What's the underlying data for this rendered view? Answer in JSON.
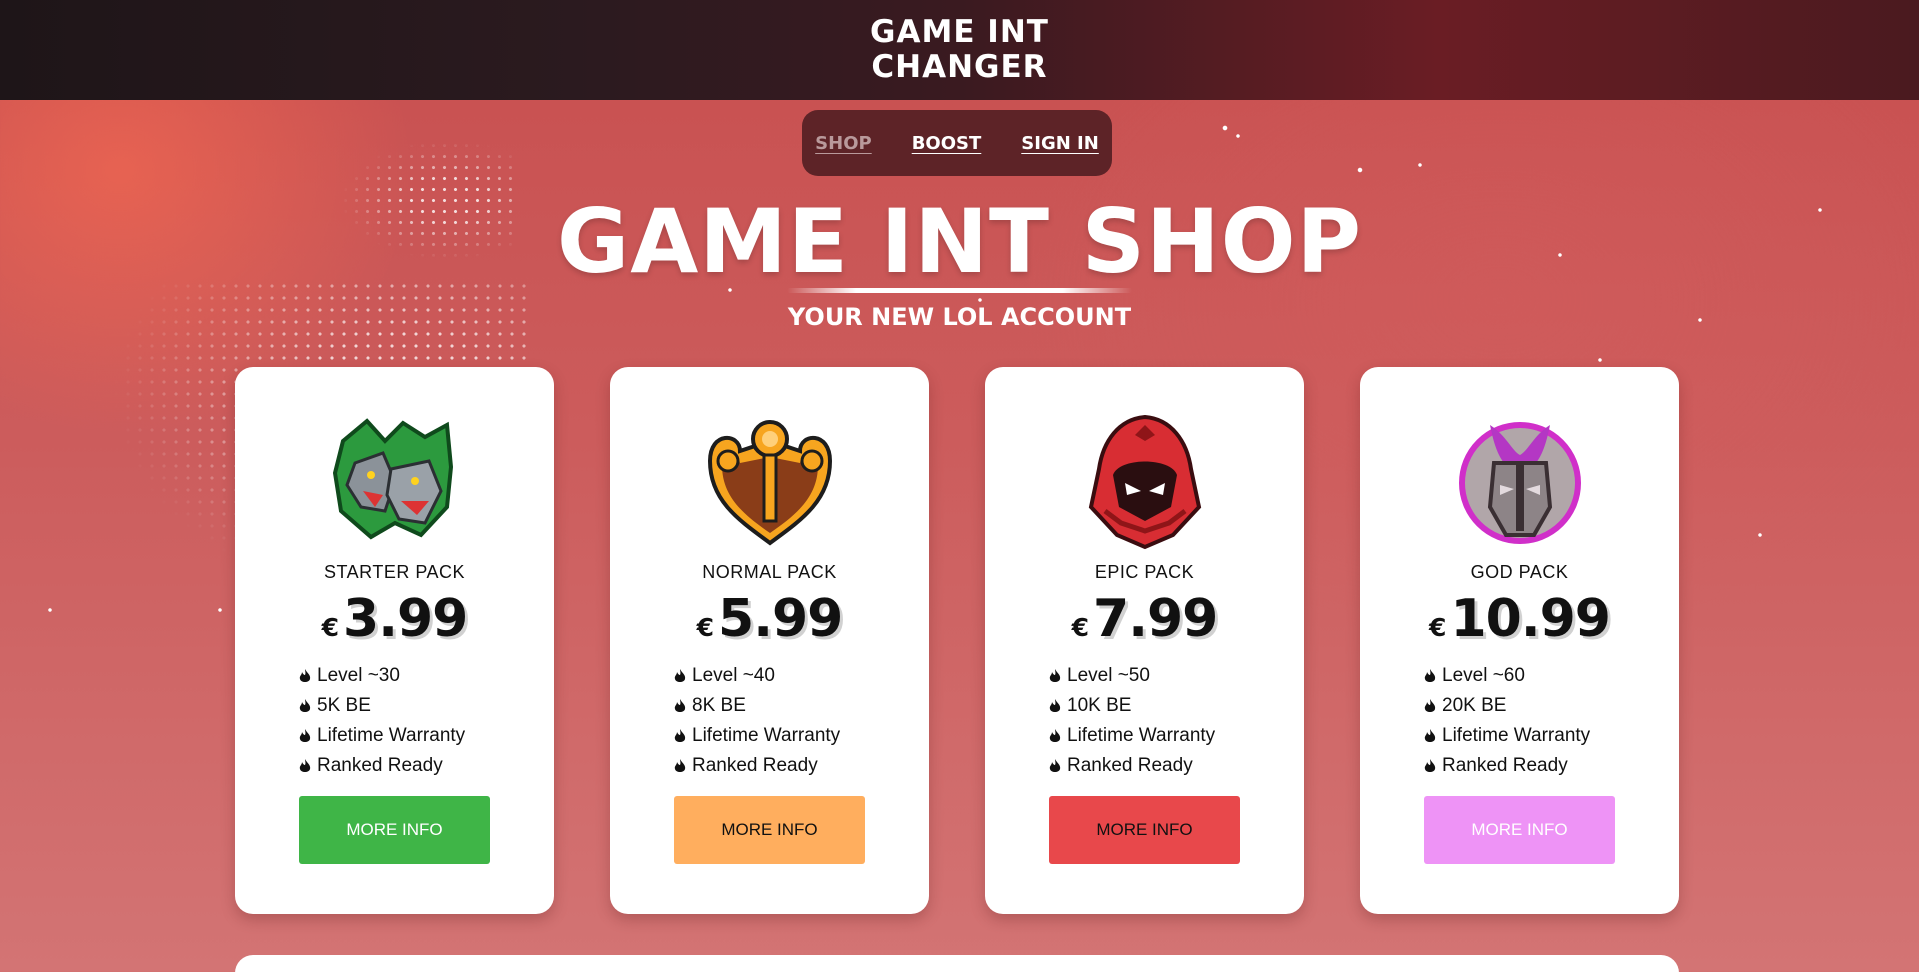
{
  "header": {
    "logo_line1": "GAME INT",
    "logo_line2": "CHANGER"
  },
  "nav": {
    "items": [
      {
        "label": "SHOP",
        "active": true
      },
      {
        "label": "BOOST",
        "active": false
      },
      {
        "label": "SIGN IN",
        "active": false
      }
    ]
  },
  "hero": {
    "title": "GAME INT SHOP",
    "subtitle": "YOUR NEW LOL ACCOUNT"
  },
  "cards": [
    {
      "name": "STARTER PACK",
      "currency": "€",
      "price": "3.99",
      "icon": "wolf-emblem-icon",
      "features": [
        "Level ~30",
        "5K BE",
        "Lifetime Warranty",
        "Ranked Ready"
      ],
      "button": "MORE INFO",
      "button_color": "#3fb547",
      "button_text_color": "#ffffff"
    },
    {
      "name": "NORMAL PACK",
      "currency": "€",
      "price": "5.99",
      "icon": "trophy-emblem-icon",
      "features": [
        "Level ~40",
        "8K BE",
        "Lifetime Warranty",
        "Ranked Ready"
      ],
      "button": "MORE INFO",
      "button_color": "#ffae5e",
      "button_text_color": "#111111"
    },
    {
      "name": "EPIC PACK",
      "currency": "€",
      "price": "7.99",
      "icon": "hooded-mask-emblem-icon",
      "features": [
        "Level ~50",
        "10K BE",
        "Lifetime Warranty",
        "Ranked Ready"
      ],
      "button": "MORE INFO",
      "button_color": "#e8484b",
      "button_text_color": "#111111"
    },
    {
      "name": "GOD PACK",
      "currency": "€",
      "price": "10.99",
      "icon": "knight-helmet-emblem-icon",
      "features": [
        "Level ~60",
        "20K BE",
        "Lifetime Warranty",
        "Ranked Ready"
      ],
      "button": "MORE INFO",
      "button_color": "#ee93f6",
      "button_text_color": "#ffffff"
    }
  ]
}
